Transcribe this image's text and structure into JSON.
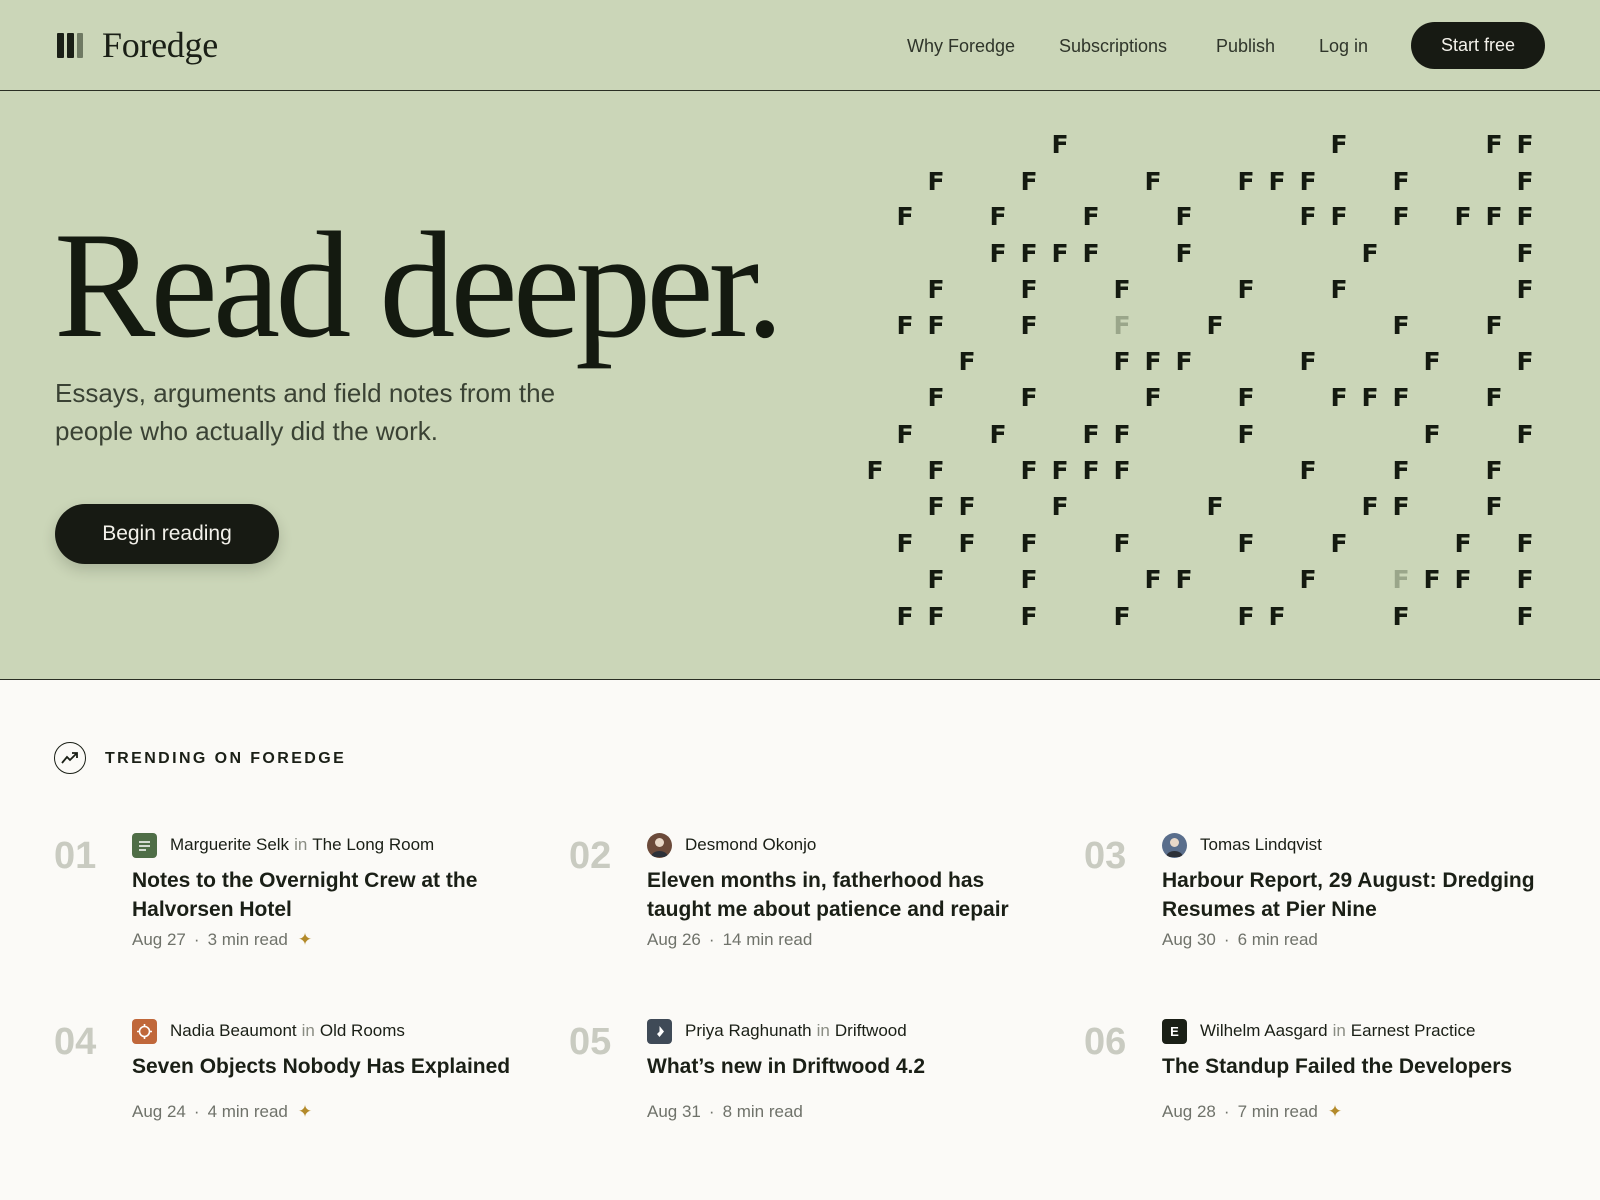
{
  "brand": {
    "name": "Foredge"
  },
  "nav": {
    "items": [
      "Why Foredge",
      "Subscriptions",
      "Publish",
      "Log in"
    ],
    "cta": "Start free"
  },
  "hero": {
    "title": "Read deeper.",
    "subtitle": "Essays, arguments and field notes from the people who actually did the work.",
    "button": "Begin reading",
    "pattern_letter": "F"
  },
  "trending": {
    "label": "TRENDING ON FOREDGE",
    "articles": [
      {
        "num": "01",
        "author": "Marguerite Selk",
        "in": "in",
        "publication": "The Long Room",
        "icon": "document-icon",
        "icon_color": "#4f6e47",
        "title": "Notes to the Overnight Crew at the Halvorsen Hotel",
        "date": "Aug 27",
        "read": "3 min read",
        "starred": true
      },
      {
        "num": "02",
        "author": "Desmond Okonjo",
        "in": "",
        "publication": "",
        "icon": "avatar-icon",
        "icon_color": "#6b4a3a",
        "title": "Eleven months in, fatherhood has taught me about patience and repair",
        "date": "Aug 26",
        "read": "14 min read",
        "starred": false
      },
      {
        "num": "03",
        "author": "Tomas Lindqvist",
        "in": "",
        "publication": "",
        "icon": "avatar-icon",
        "icon_color": "#5a6e8c",
        "title": "Harbour Report, 29 August: Dredging Resumes at Pier Nine",
        "date": "Aug 30",
        "read": "6 min read",
        "starred": false
      },
      {
        "num": "04",
        "author": "Nadia Beaumont",
        "in": "in",
        "publication": "Old Rooms",
        "icon": "target-icon",
        "icon_color": "#c0673a",
        "title": "Seven Objects Nobody Has Explained",
        "date": "Aug 24",
        "read": "4 min read",
        "starred": true
      },
      {
        "num": "05",
        "author": "Priya Raghunath",
        "in": "in",
        "publication": "Driftwood",
        "icon": "diamond-icon",
        "icon_color": "#3f4a57",
        "title": "What’s new in Driftwood 4.2",
        "date": "Aug 31",
        "read": "8 min read",
        "starred": false
      },
      {
        "num": "06",
        "author": "Wilhelm Aasgard",
        "in": "in",
        "publication": "Earnest Practice",
        "icon": "letter-e-icon",
        "icon_color": "#1a1f16",
        "title": "The Standup Failed the Developers",
        "date": "Aug 28",
        "read": "7 min read",
        "starred": true
      }
    ]
  },
  "colors": {
    "hero_bg": "#cbd6b8",
    "ink": "#1a1f16",
    "accent_star": "#b38a2a"
  }
}
